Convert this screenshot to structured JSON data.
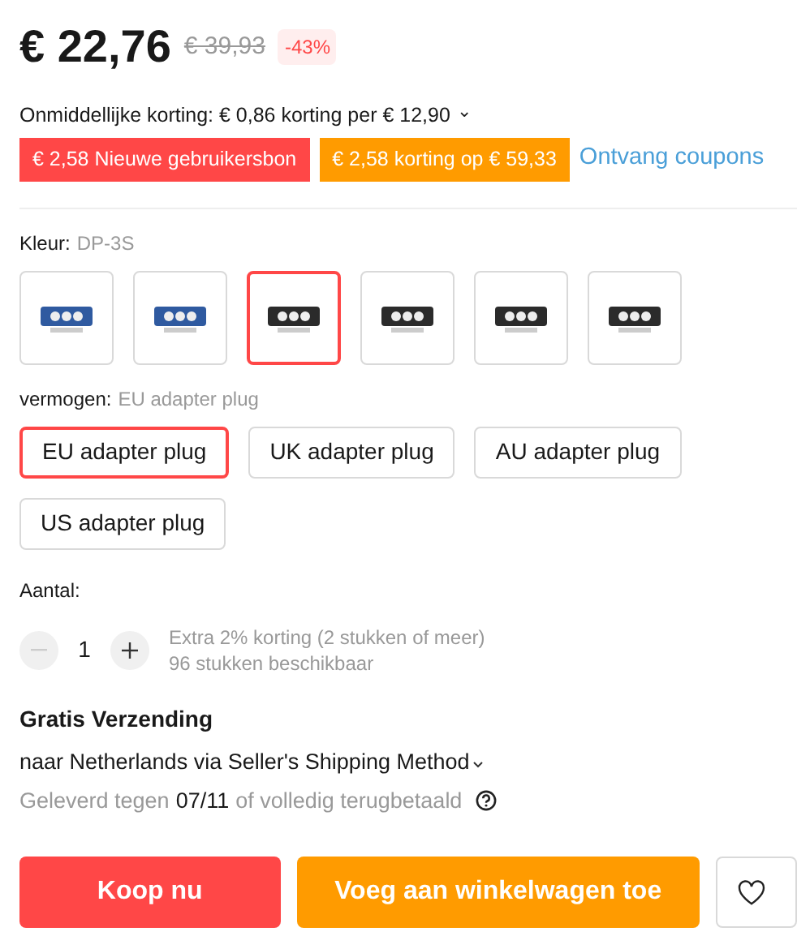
{
  "price": {
    "current": "€ 22,76",
    "original": "€ 39,93",
    "discount": "-43%"
  },
  "instant_discount": {
    "text": "Onmiddellijke korting: € 0,86 korting per € 12,90",
    "caret": "⌄"
  },
  "coupons": [
    {
      "label": "€ 2,58 Nieuwe gebruikersbon",
      "color": "#ff4747"
    },
    {
      "label": "€ 2,58 korting op € 59,33",
      "color": "#ff9b00"
    }
  ],
  "coupons_link": "Ontvang coupons",
  "color_option": {
    "label": "Kleur:",
    "value": "DP-3S",
    "thumbnails": [
      {
        "selected": false
      },
      {
        "selected": false
      },
      {
        "selected": true
      },
      {
        "selected": false
      },
      {
        "selected": false
      },
      {
        "selected": false
      }
    ]
  },
  "power_option": {
    "label": "vermogen:",
    "value": "EU adapter plug",
    "options": [
      {
        "label": "EU adapter plug",
        "selected": true
      },
      {
        "label": "UK adapter plug",
        "selected": false
      },
      {
        "label": "AU adapter plug",
        "selected": false
      },
      {
        "label": "US adapter plug",
        "selected": false
      }
    ]
  },
  "quantity": {
    "label": "Aantal:",
    "value": "1",
    "decrease_disabled": true,
    "note": "Extra 2% korting (2 stukken of meer)",
    "available": "96 stukken beschikbaar"
  },
  "shipping": {
    "title": "Gratis Verzending",
    "route": "naar Netherlands via Seller's Shipping Method",
    "delivery_prefix": "Geleverd tegen",
    "delivery_date": "07/11",
    "delivery_suffix": "of volledig terugbetaald"
  },
  "buttons": [
    {
      "label": "Koop nu",
      "kind": "buy"
    },
    {
      "label": "Voeg aan winkelwagen toe",
      "kind": "cart"
    }
  ]
}
